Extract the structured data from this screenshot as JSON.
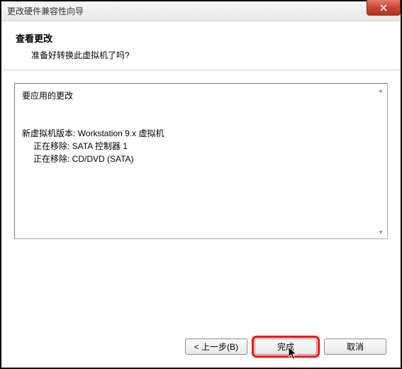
{
  "titlebar": {
    "text": "更改硬件兼容性向导"
  },
  "header": {
    "title": "查看更改",
    "subtitle": "准备好转换此虚拟机了吗?"
  },
  "changes": {
    "label": "要应用的更改",
    "line1": "新虚拟机版本: Workstation 9.x 虚拟机",
    "line2": "正在移除: SATA 控制器 1",
    "line3": "正在移除: CD/DVD (SATA)"
  },
  "buttons": {
    "back": "< 上一步(B)",
    "finish": "完成",
    "cancel": "取消"
  }
}
